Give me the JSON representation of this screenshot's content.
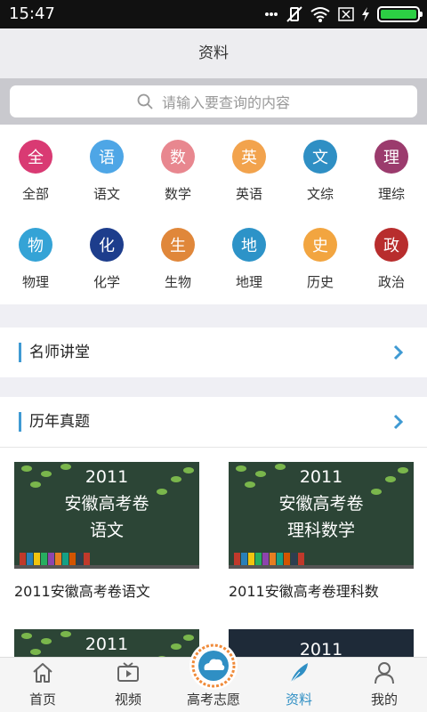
{
  "status": {
    "time": "15:47"
  },
  "header": {
    "title": "资料"
  },
  "search": {
    "placeholder": "请输入要查询的内容"
  },
  "categories": [
    {
      "label": "全部",
      "glyph": "全",
      "color": "#d93a73",
      "icon": "all-icon"
    },
    {
      "label": "语文",
      "glyph": "语",
      "color": "#4ea6e6",
      "icon": "chinese-icon"
    },
    {
      "label": "数学",
      "glyph": "数",
      "color": "#e8878f",
      "icon": "math-icon"
    },
    {
      "label": "英语",
      "glyph": "英",
      "color": "#f2a34d",
      "icon": "english-icon"
    },
    {
      "label": "文综",
      "glyph": "文",
      "color": "#2f8fc4",
      "icon": "liberal-arts-icon"
    },
    {
      "label": "理综",
      "glyph": "理",
      "color": "#9b3b6d",
      "icon": "science-icon"
    },
    {
      "label": "物理",
      "glyph": "物",
      "color": "#34a3d6",
      "icon": "physics-icon"
    },
    {
      "label": "化学",
      "glyph": "化",
      "color": "#1d3d8c",
      "icon": "chemistry-icon"
    },
    {
      "label": "生物",
      "glyph": "生",
      "color": "#e0873a",
      "icon": "biology-icon"
    },
    {
      "label": "地理",
      "glyph": "地",
      "color": "#2d93c8",
      "icon": "geography-icon"
    },
    {
      "label": "历史",
      "glyph": "史",
      "color": "#f2a540",
      "icon": "history-icon"
    },
    {
      "label": "政治",
      "glyph": "政",
      "color": "#b82d2d",
      "icon": "politics-icon"
    }
  ],
  "sections": {
    "lecture": {
      "title": "名师讲堂"
    },
    "past_papers": {
      "title": "历年真题"
    }
  },
  "papers": [
    {
      "lines": [
        "2011",
        "安徽高考卷",
        "语文"
      ],
      "caption": "2011安徽高考卷语文"
    },
    {
      "lines": [
        "2011",
        "安徽高考卷",
        "理科数学"
      ],
      "caption": "2011安徽高考卷理科数"
    },
    {
      "lines": [
        "2011"
      ],
      "caption": ""
    },
    {
      "lines": [
        "2011"
      ],
      "caption": ""
    }
  ],
  "tabbar": {
    "items": [
      {
        "label": "首页",
        "icon": "home-icon"
      },
      {
        "label": "视频",
        "icon": "video-icon"
      },
      {
        "label": "高考志愿",
        "icon": "cloud-icon"
      },
      {
        "label": "资料",
        "icon": "feather-icon"
      },
      {
        "label": "我的",
        "icon": "profile-icon"
      }
    ],
    "active": "资料"
  },
  "colors": {
    "accent": "#3f9ad3",
    "tab_active": "#2f8fc4"
  }
}
